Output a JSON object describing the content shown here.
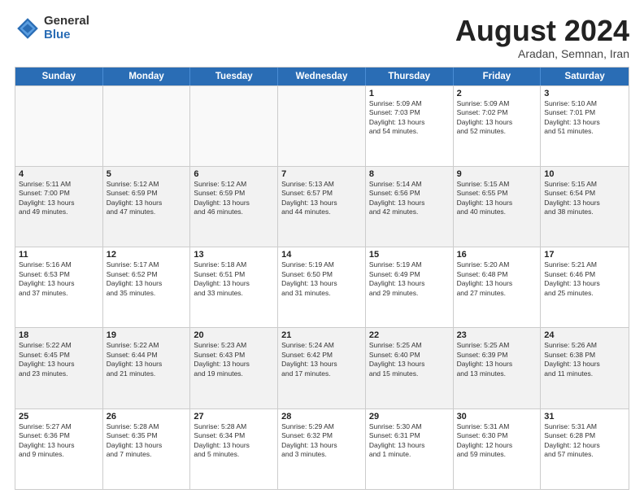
{
  "logo": {
    "general": "General",
    "blue": "Blue"
  },
  "title": "August 2024",
  "location": "Aradan, Semnan, Iran",
  "days": [
    "Sunday",
    "Monday",
    "Tuesday",
    "Wednesday",
    "Thursday",
    "Friday",
    "Saturday"
  ],
  "rows": [
    [
      {
        "day": "",
        "detail": ""
      },
      {
        "day": "",
        "detail": ""
      },
      {
        "day": "",
        "detail": ""
      },
      {
        "day": "",
        "detail": ""
      },
      {
        "day": "1",
        "detail": "Sunrise: 5:09 AM\nSunset: 7:03 PM\nDaylight: 13 hours\nand 54 minutes."
      },
      {
        "day": "2",
        "detail": "Sunrise: 5:09 AM\nSunset: 7:02 PM\nDaylight: 13 hours\nand 52 minutes."
      },
      {
        "day": "3",
        "detail": "Sunrise: 5:10 AM\nSunset: 7:01 PM\nDaylight: 13 hours\nand 51 minutes."
      }
    ],
    [
      {
        "day": "4",
        "detail": "Sunrise: 5:11 AM\nSunset: 7:00 PM\nDaylight: 13 hours\nand 49 minutes."
      },
      {
        "day": "5",
        "detail": "Sunrise: 5:12 AM\nSunset: 6:59 PM\nDaylight: 13 hours\nand 47 minutes."
      },
      {
        "day": "6",
        "detail": "Sunrise: 5:12 AM\nSunset: 6:59 PM\nDaylight: 13 hours\nand 46 minutes."
      },
      {
        "day": "7",
        "detail": "Sunrise: 5:13 AM\nSunset: 6:57 PM\nDaylight: 13 hours\nand 44 minutes."
      },
      {
        "day": "8",
        "detail": "Sunrise: 5:14 AM\nSunset: 6:56 PM\nDaylight: 13 hours\nand 42 minutes."
      },
      {
        "day": "9",
        "detail": "Sunrise: 5:15 AM\nSunset: 6:55 PM\nDaylight: 13 hours\nand 40 minutes."
      },
      {
        "day": "10",
        "detail": "Sunrise: 5:15 AM\nSunset: 6:54 PM\nDaylight: 13 hours\nand 38 minutes."
      }
    ],
    [
      {
        "day": "11",
        "detail": "Sunrise: 5:16 AM\nSunset: 6:53 PM\nDaylight: 13 hours\nand 37 minutes."
      },
      {
        "day": "12",
        "detail": "Sunrise: 5:17 AM\nSunset: 6:52 PM\nDaylight: 13 hours\nand 35 minutes."
      },
      {
        "day": "13",
        "detail": "Sunrise: 5:18 AM\nSunset: 6:51 PM\nDaylight: 13 hours\nand 33 minutes."
      },
      {
        "day": "14",
        "detail": "Sunrise: 5:19 AM\nSunset: 6:50 PM\nDaylight: 13 hours\nand 31 minutes."
      },
      {
        "day": "15",
        "detail": "Sunrise: 5:19 AM\nSunset: 6:49 PM\nDaylight: 13 hours\nand 29 minutes."
      },
      {
        "day": "16",
        "detail": "Sunrise: 5:20 AM\nSunset: 6:48 PM\nDaylight: 13 hours\nand 27 minutes."
      },
      {
        "day": "17",
        "detail": "Sunrise: 5:21 AM\nSunset: 6:46 PM\nDaylight: 13 hours\nand 25 minutes."
      }
    ],
    [
      {
        "day": "18",
        "detail": "Sunrise: 5:22 AM\nSunset: 6:45 PM\nDaylight: 13 hours\nand 23 minutes."
      },
      {
        "day": "19",
        "detail": "Sunrise: 5:22 AM\nSunset: 6:44 PM\nDaylight: 13 hours\nand 21 minutes."
      },
      {
        "day": "20",
        "detail": "Sunrise: 5:23 AM\nSunset: 6:43 PM\nDaylight: 13 hours\nand 19 minutes."
      },
      {
        "day": "21",
        "detail": "Sunrise: 5:24 AM\nSunset: 6:42 PM\nDaylight: 13 hours\nand 17 minutes."
      },
      {
        "day": "22",
        "detail": "Sunrise: 5:25 AM\nSunset: 6:40 PM\nDaylight: 13 hours\nand 15 minutes."
      },
      {
        "day": "23",
        "detail": "Sunrise: 5:25 AM\nSunset: 6:39 PM\nDaylight: 13 hours\nand 13 minutes."
      },
      {
        "day": "24",
        "detail": "Sunrise: 5:26 AM\nSunset: 6:38 PM\nDaylight: 13 hours\nand 11 minutes."
      }
    ],
    [
      {
        "day": "25",
        "detail": "Sunrise: 5:27 AM\nSunset: 6:36 PM\nDaylight: 13 hours\nand 9 minutes."
      },
      {
        "day": "26",
        "detail": "Sunrise: 5:28 AM\nSunset: 6:35 PM\nDaylight: 13 hours\nand 7 minutes."
      },
      {
        "day": "27",
        "detail": "Sunrise: 5:28 AM\nSunset: 6:34 PM\nDaylight: 13 hours\nand 5 minutes."
      },
      {
        "day": "28",
        "detail": "Sunrise: 5:29 AM\nSunset: 6:32 PM\nDaylight: 13 hours\nand 3 minutes."
      },
      {
        "day": "29",
        "detail": "Sunrise: 5:30 AM\nSunset: 6:31 PM\nDaylight: 13 hours\nand 1 minute."
      },
      {
        "day": "30",
        "detail": "Sunrise: 5:31 AM\nSunset: 6:30 PM\nDaylight: 12 hours\nand 59 minutes."
      },
      {
        "day": "31",
        "detail": "Sunrise: 5:31 AM\nSunset: 6:28 PM\nDaylight: 12 hours\nand 57 minutes."
      }
    ]
  ]
}
